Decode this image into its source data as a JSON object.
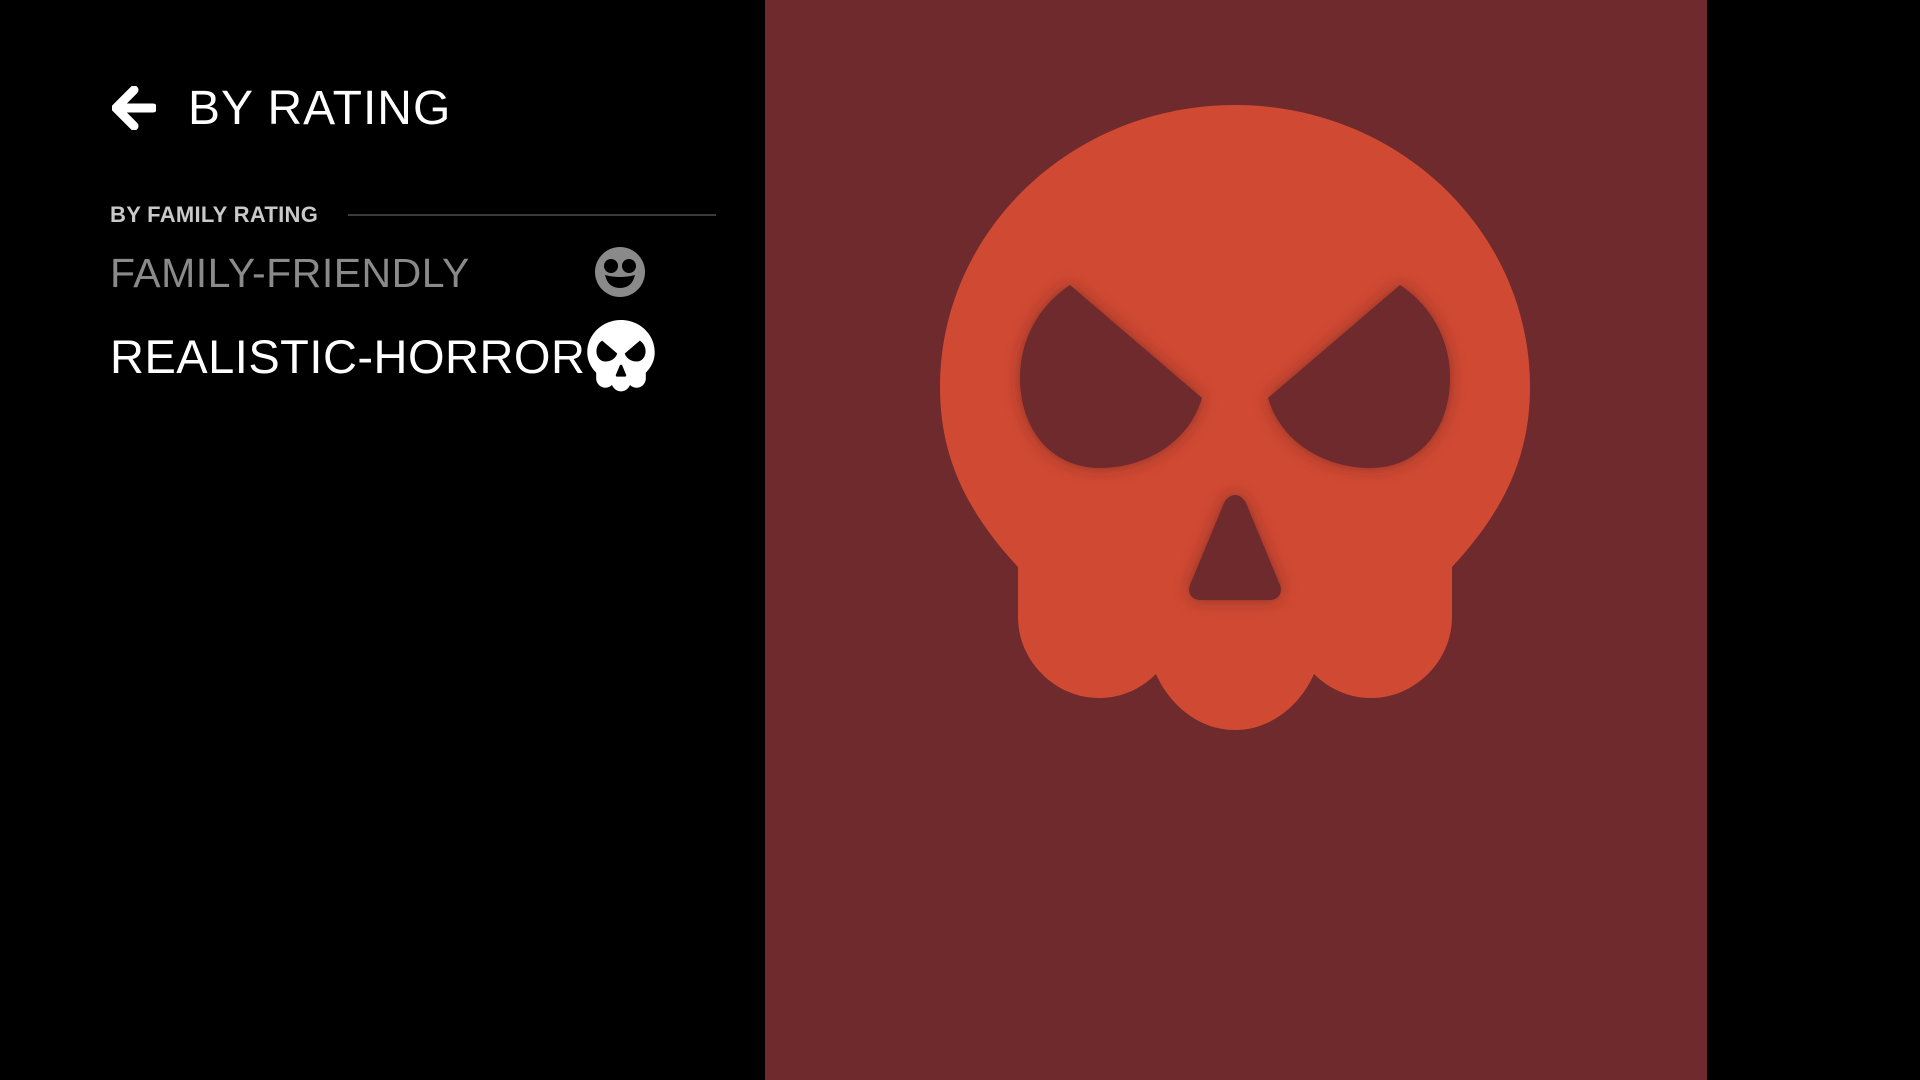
{
  "header": {
    "title": "BY RATING",
    "back_icon": "arrow-left-icon"
  },
  "section": {
    "label": "BY FAMILY RATING"
  },
  "ratings": [
    {
      "label": "FAMILY-FRIENDLY",
      "icon": "smiley-face-icon",
      "selected": false
    },
    {
      "label": "REALISTIC-HORROR",
      "icon": "skull-icon",
      "selected": true
    }
  ],
  "preview": {
    "icon": "skull-icon",
    "background_color": "#6e2a2d",
    "icon_color": "#d04a33"
  },
  "colors": {
    "background": "#000000",
    "text_active": "#ffffff",
    "text_inactive": "#8a8a8a",
    "section_label": "#c9c9c9"
  }
}
